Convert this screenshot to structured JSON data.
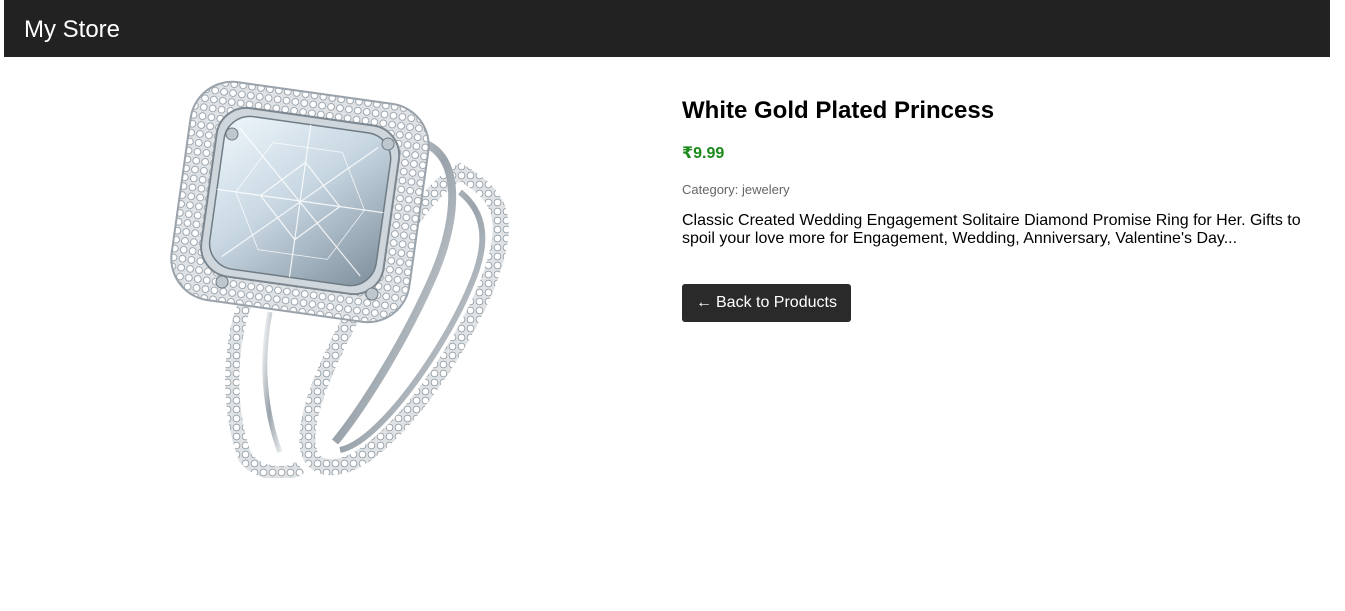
{
  "header": {
    "brand": "My Store"
  },
  "product": {
    "image_alt": "White Gold Plated Princess ring",
    "title": "White Gold Plated Princess",
    "price": "₹9.99",
    "category_label": "Category: jewelery",
    "description": "Classic Created Wedding Engagement Solitaire Diamond Promise Ring for Her. Gifts to spoil your love more for Engagement, Wedding, Anniversary, Valentine's Day..."
  },
  "actions": {
    "back_arrow": "←",
    "back_label": "Back to Products"
  },
  "colors": {
    "header_bg": "#222222",
    "price": "#1a8a1a",
    "button_bg": "#2a2a2a"
  }
}
